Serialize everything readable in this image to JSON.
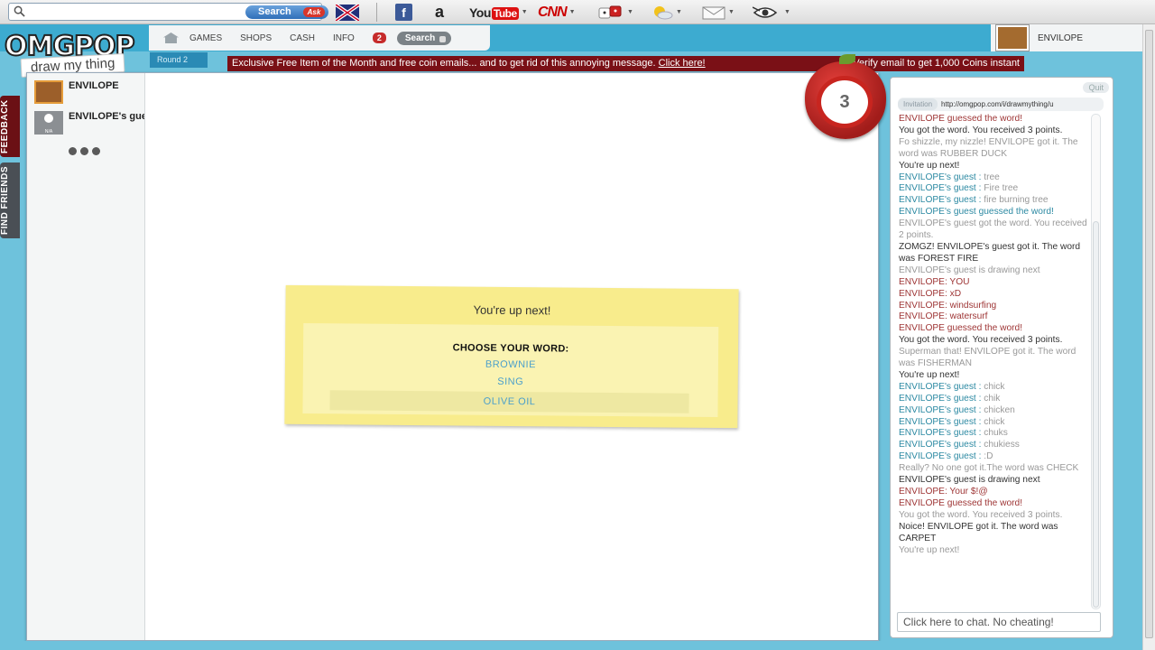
{
  "toolbar": {
    "search_label": "Search",
    "ask_label": "Ask",
    "youtube_you": "You",
    "youtube_tube": "Tube",
    "cnn_label": "CNN",
    "amazon_label": "a",
    "facebook_label": "f"
  },
  "game": {
    "logo_text": "OMGPOP",
    "logo_tagline": "draw my thing",
    "nav": {
      "games": "GAMES",
      "shops": "SHOPS",
      "cash": "CASH",
      "info": "INFO",
      "badge": "2",
      "search": "Search"
    },
    "user_name": "ENVILOPE",
    "round": "Round 2",
    "banner_text": "Exclusive Free Item of the Month and free coin emails... and to get rid of this annoying message.",
    "banner_link": "Click here!",
    "banner_tail": "Verify email to get 1,000 Coins instant",
    "side_feedback": "FEEDBACK",
    "side_find": "FIND FRIENDS",
    "timer": "3",
    "colors": {
      "header_blue": "#3dabd0",
      "banner_red": "#7a1016",
      "card_yellow": "#f8ec8c",
      "word_blue": "#4a9fcb"
    }
  },
  "players": [
    {
      "name": "ENVILOPE"
    },
    {
      "name": "ENVILOPE's guest",
      "avatar_label": "N/A"
    }
  ],
  "card": {
    "title": "You're up next!",
    "choose": "CHOOSE YOUR WORD:",
    "words": [
      "BROWNIE",
      "SING",
      "OLIVE OIL"
    ],
    "selected_index": 2
  },
  "chat": {
    "quit": "Quit",
    "invite_label": "Invitation",
    "invite_url": "http://omgpop.com/i/drawmything/u",
    "input_placeholder": "Click here to chat. No cheating!",
    "messages": [
      {
        "text": "ENVILOPE guessed the word!",
        "cls": "c-red"
      },
      {
        "text": "You got the word. You received 3 points.",
        "cls": "c-dark"
      },
      {
        "text": "Fo shizzle, my nizzle! ENVILOPE got it. The word was RUBBER DUCK",
        "cls": "c-grey"
      },
      {
        "text": "You're up next!",
        "cls": "c-dark"
      },
      {
        "name": "ENVILOPE's guest",
        "sep": " : ",
        "text": "tree",
        "cls": "c-blue"
      },
      {
        "name": "ENVILOPE's guest",
        "sep": " : ",
        "text": "Fire tree",
        "cls": "c-blue"
      },
      {
        "name": "ENVILOPE's guest",
        "sep": " : ",
        "text": "fire burning tree",
        "cls": "c-blue"
      },
      {
        "text": "ENVILOPE's guest  guessed the word!",
        "cls": "c-blue"
      },
      {
        "text": "ENVILOPE's guest  got the word. You received 2 points.",
        "cls": "c-grey"
      },
      {
        "text": "ZOMGZ! ENVILOPE's guest  got it. The word was FOREST FIRE",
        "cls": "c-dark"
      },
      {
        "text": "ENVILOPE's guest  is drawing next",
        "cls": "c-grey"
      },
      {
        "text": "ENVILOPE: YOU",
        "cls": "c-red"
      },
      {
        "text": "ENVILOPE: xD",
        "cls": "c-red"
      },
      {
        "text": "ENVILOPE: windsurfing",
        "cls": "c-red"
      },
      {
        "text": "ENVILOPE: watersurf",
        "cls": "c-red"
      },
      {
        "text": "ENVILOPE guessed the word!",
        "cls": "c-red"
      },
      {
        "text": "You got the word. You received 3 points.",
        "cls": "c-dark"
      },
      {
        "text": "Superman that! ENVILOPE got it. The word was FISHERMAN",
        "cls": "c-grey"
      },
      {
        "text": "You're up next!",
        "cls": "c-dark"
      },
      {
        "name": "ENVILOPE's guest",
        "sep": " : ",
        "text": "chick",
        "cls": "c-blue"
      },
      {
        "name": "ENVILOPE's guest",
        "sep": " : ",
        "text": "chik",
        "cls": "c-blue"
      },
      {
        "name": "ENVILOPE's guest",
        "sep": " : ",
        "text": "chicken",
        "cls": "c-blue"
      },
      {
        "name": "ENVILOPE's guest",
        "sep": " : ",
        "text": "chick",
        "cls": "c-blue"
      },
      {
        "name": "ENVILOPE's guest",
        "sep": " : ",
        "text": "chuks",
        "cls": "c-blue"
      },
      {
        "name": "ENVILOPE's guest",
        "sep": " : ",
        "text": "chukiess",
        "cls": "c-blue"
      },
      {
        "name": "ENVILOPE's guest",
        "sep": " : ",
        "text": ":D",
        "cls": "c-blue"
      },
      {
        "text": "Really? No one got it.The word was CHECK",
        "cls": "c-grey"
      },
      {
        "text": "ENVILOPE's guest  is drawing next",
        "cls": "c-dark"
      },
      {
        "text": "ENVILOPE: Your $!@",
        "cls": "c-red"
      },
      {
        "text": "ENVILOPE guessed the word!",
        "cls": "c-red"
      },
      {
        "text": "You got the word. You received 3 points.",
        "cls": "c-grey"
      },
      {
        "text": "Noice! ENVILOPE got it. The word was CARPET",
        "cls": "c-dark"
      },
      {
        "text": "You're up next!",
        "cls": "c-grey"
      }
    ]
  }
}
